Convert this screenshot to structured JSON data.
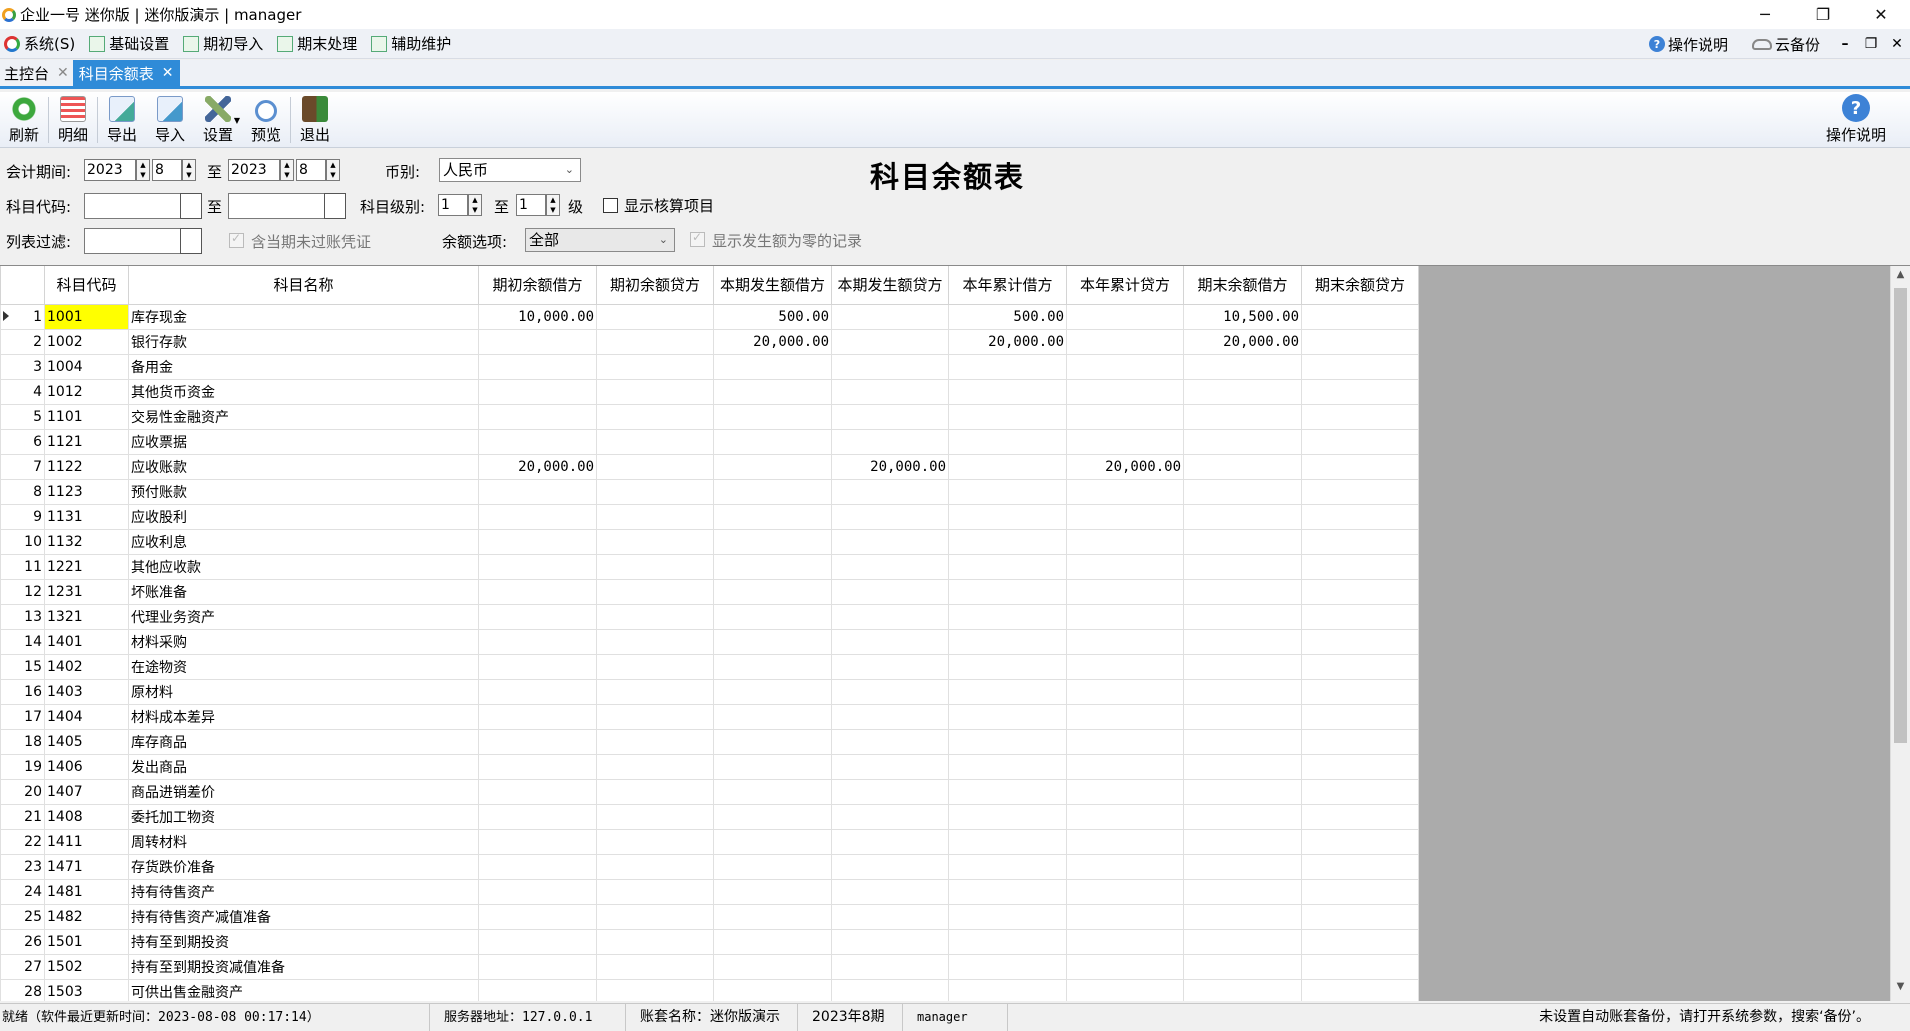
{
  "window": {
    "title": "企业一号 迷你版 | 迷你版演示 | manager",
    "minimize": "─",
    "restore": "❐",
    "close": "✕"
  },
  "menu": {
    "items": [
      {
        "label": "系统(S)",
        "icon": "system-icon"
      },
      {
        "label": "基础设置",
        "icon": "settings-doc-icon"
      },
      {
        "label": "期初导入",
        "icon": "edit-doc-icon"
      },
      {
        "label": "期末处理",
        "icon": "tools-icon"
      },
      {
        "label": "辅助维护",
        "icon": "chart-icon"
      }
    ],
    "help_label": "操作说明",
    "backup_label": "云备份"
  },
  "tabs": [
    {
      "label": "主控台",
      "active": false
    },
    {
      "label": "科目余额表",
      "active": true
    }
  ],
  "toolbar": {
    "refresh": "刷新",
    "detail": "明细",
    "export": "导出",
    "import": "导入",
    "settings": "设置",
    "preview": "预览",
    "exit": "退出",
    "help": "操作说明"
  },
  "filter": {
    "period_label": "会计期间:",
    "year_from": "2023",
    "month_from": "8",
    "to": "至",
    "year_to": "2023",
    "month_to": "8",
    "currency_label": "币别:",
    "currency": "人民币",
    "code_label": "科目代码:",
    "code_from": "",
    "code_to": "",
    "level_label": "科目级别:",
    "level_from": "1",
    "level_to": "1",
    "level_suffix": "级",
    "show_aux_label": "显示核算项目",
    "list_filter_label": "列表过滤:",
    "list_filter": "",
    "include_unposted_label": "含当期未过账凭证",
    "balance_option_label": "余额选项:",
    "balance_option": "全部",
    "show_zero_label": "显示发生额为零的记录"
  },
  "report_title": "科目余额表",
  "table": {
    "columns": [
      "",
      "科目代码",
      "科目名称",
      "期初余额借方",
      "期初余额贷方",
      "本期发生额借方",
      "本期发生额贷方",
      "本年累计借方",
      "本年累计贷方",
      "期末余额借方",
      "期末余额贷方"
    ],
    "rows": [
      [
        "1",
        "1001",
        "库存现金",
        "10,000.00",
        "",
        "500.00",
        "",
        "500.00",
        "",
        "10,500.00",
        ""
      ],
      [
        "2",
        "1002",
        "银行存款",
        "",
        "",
        "20,000.00",
        "",
        "20,000.00",
        "",
        "20,000.00",
        ""
      ],
      [
        "3",
        "1004",
        "备用金",
        "",
        "",
        "",
        "",
        "",
        "",
        "",
        ""
      ],
      [
        "4",
        "1012",
        "其他货币资金",
        "",
        "",
        "",
        "",
        "",
        "",
        "",
        ""
      ],
      [
        "5",
        "1101",
        "交易性金融资产",
        "",
        "",
        "",
        "",
        "",
        "",
        "",
        ""
      ],
      [
        "6",
        "1121",
        "应收票据",
        "",
        "",
        "",
        "",
        "",
        "",
        "",
        ""
      ],
      [
        "7",
        "1122",
        "应收账款",
        "20,000.00",
        "",
        "",
        "20,000.00",
        "",
        "20,000.00",
        "",
        ""
      ],
      [
        "8",
        "1123",
        "预付账款",
        "",
        "",
        "",
        "",
        "",
        "",
        "",
        ""
      ],
      [
        "9",
        "1131",
        "应收股利",
        "",
        "",
        "",
        "",
        "",
        "",
        "",
        ""
      ],
      [
        "10",
        "1132",
        "应收利息",
        "",
        "",
        "",
        "",
        "",
        "",
        "",
        ""
      ],
      [
        "11",
        "1221",
        "其他应收款",
        "",
        "",
        "",
        "",
        "",
        "",
        "",
        ""
      ],
      [
        "12",
        "1231",
        "坏账准备",
        "",
        "",
        "",
        "",
        "",
        "",
        "",
        ""
      ],
      [
        "13",
        "1321",
        "代理业务资产",
        "",
        "",
        "",
        "",
        "",
        "",
        "",
        ""
      ],
      [
        "14",
        "1401",
        "材料采购",
        "",
        "",
        "",
        "",
        "",
        "",
        "",
        ""
      ],
      [
        "15",
        "1402",
        "在途物资",
        "",
        "",
        "",
        "",
        "",
        "",
        "",
        ""
      ],
      [
        "16",
        "1403",
        "原材料",
        "",
        "",
        "",
        "",
        "",
        "",
        "",
        ""
      ],
      [
        "17",
        "1404",
        "材料成本差异",
        "",
        "",
        "",
        "",
        "",
        "",
        "",
        ""
      ],
      [
        "18",
        "1405",
        "库存商品",
        "",
        "",
        "",
        "",
        "",
        "",
        "",
        ""
      ],
      [
        "19",
        "1406",
        "发出商品",
        "",
        "",
        "",
        "",
        "",
        "",
        "",
        ""
      ],
      [
        "20",
        "1407",
        "商品进销差价",
        "",
        "",
        "",
        "",
        "",
        "",
        "",
        ""
      ],
      [
        "21",
        "1408",
        "委托加工物资",
        "",
        "",
        "",
        "",
        "",
        "",
        "",
        ""
      ],
      [
        "22",
        "1411",
        "周转材料",
        "",
        "",
        "",
        "",
        "",
        "",
        "",
        ""
      ],
      [
        "23",
        "1471",
        "存货跌价准备",
        "",
        "",
        "",
        "",
        "",
        "",
        "",
        ""
      ],
      [
        "24",
        "1481",
        "持有待售资产",
        "",
        "",
        "",
        "",
        "",
        "",
        "",
        ""
      ],
      [
        "25",
        "1482",
        "持有待售资产减值准备",
        "",
        "",
        "",
        "",
        "",
        "",
        "",
        ""
      ],
      [
        "26",
        "1501",
        "持有至到期投资",
        "",
        "",
        "",
        "",
        "",
        "",
        "",
        ""
      ],
      [
        "27",
        "1502",
        "持有至到期投资减值准备",
        "",
        "",
        "",
        "",
        "",
        "",
        "",
        ""
      ],
      [
        "28",
        "1503",
        "可供出售金融资产",
        "",
        "",
        "",
        "",
        "",
        "",
        "",
        ""
      ]
    ]
  },
  "status": {
    "ready": "就绪（软件最近更新时间：2023-08-08 00:17:14）",
    "server": "服务器地址：127.0.0.1",
    "account": "账套名称：迷你版演示",
    "period": "2023年8期",
    "user": "manager",
    "notice": "未设置自动账套备份，请打开系统参数，搜索‘备份’。"
  }
}
